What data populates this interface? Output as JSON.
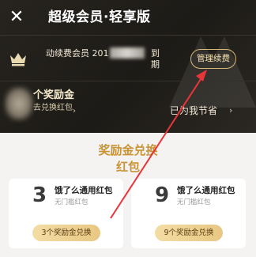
{
  "topbar": {
    "close_icon": "close-icon",
    "title": "超级会员·轻享版"
  },
  "member": {
    "crown_icon": "crown-icon",
    "text_prefix": "动续费会员 201",
    "text_suffix": "到",
    "text_suffix2": "期",
    "manage_label": "管理续费"
  },
  "reward": {
    "title": "个奖励金",
    "subtitle": "去兑换红包",
    "saved_label": "已为我节省",
    "arrow_icon": "chevron-right-icon"
  },
  "section": {
    "title": "奖励金兑换红包"
  },
  "coupons": [
    {
      "count": "3",
      "name": "饿了么通用红包",
      "desc": "无门槛红包",
      "button": "3个奖励金兑换"
    },
    {
      "count": "9",
      "name": "饿了么通用红包",
      "desc": "无门槛红包",
      "button": "9个奖励金兑换"
    }
  ],
  "colors": {
    "header_bg": "#1f1d19",
    "gold_text": "#c99336",
    "annotation_red": "#e8353a",
    "button_gold": "#ecd08e"
  }
}
